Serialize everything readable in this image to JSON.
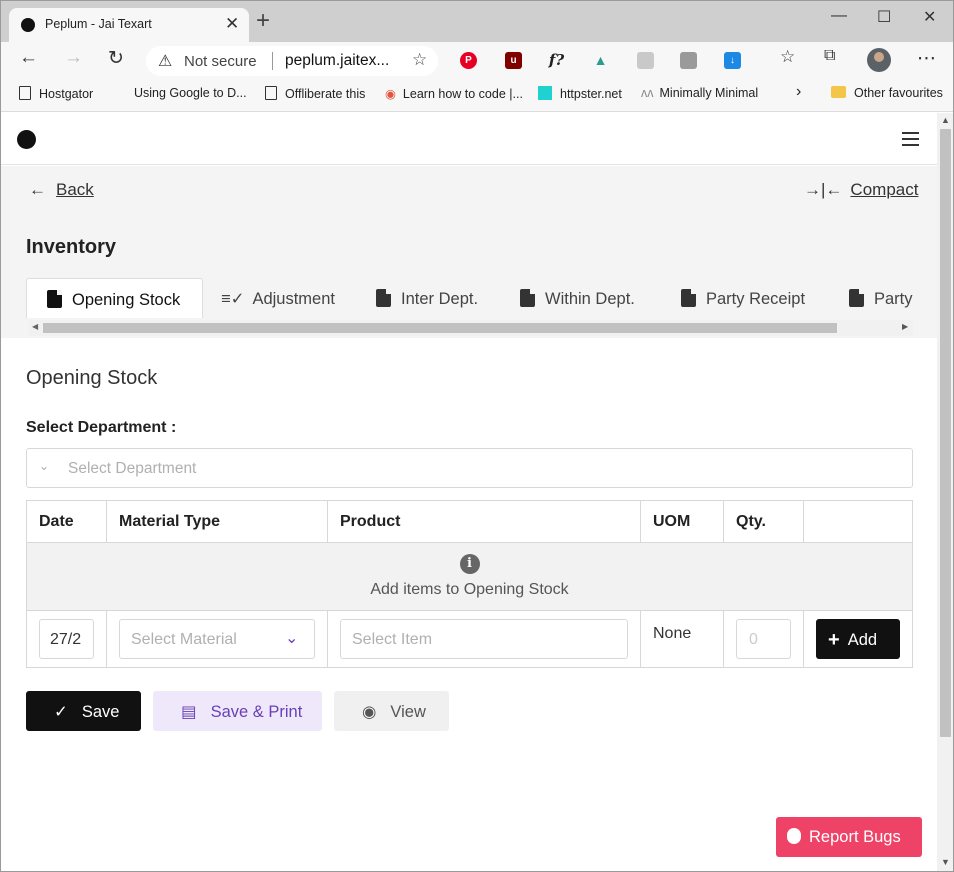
{
  "browser": {
    "tab_title": "Peplum - Jai Texart",
    "security_label": "Not secure",
    "url": "peplum.jaitex...",
    "bookmarks": [
      "Hostgator",
      "Using Google to D...",
      "Offliberate this",
      "Learn how to code |...",
      "httpster.net",
      "Minimally Minimal",
      "Other favourites"
    ]
  },
  "app": {
    "back_label": "Back",
    "compact_label": "Compact",
    "page_title": "Inventory",
    "tabs": [
      "Opening Stock",
      "Adjustment",
      "Inter Dept.",
      "Within Dept.",
      "Party Receipt",
      "Party"
    ],
    "active_tab": "Opening Stock",
    "section_title": "Opening Stock",
    "department_label": "Select Department :",
    "department_placeholder": "Select Department",
    "table": {
      "columns": [
        "Date",
        "Material Type",
        "Product",
        "UOM",
        "Qty."
      ],
      "empty_message": "Add items to Opening Stock",
      "entry": {
        "date": "27/2",
        "material_placeholder": "Select Material",
        "item_placeholder": "Select Item",
        "uom": "None",
        "qty_placeholder": "0",
        "add_label": "Add"
      }
    },
    "actions": {
      "save": "Save",
      "save_print": "Save & Print",
      "view": "View"
    },
    "report_bugs": "Report Bugs"
  },
  "colors": {
    "accent_purple": "#6a3fb5",
    "report_red": "#ee4266",
    "primary_black": "#111111"
  }
}
